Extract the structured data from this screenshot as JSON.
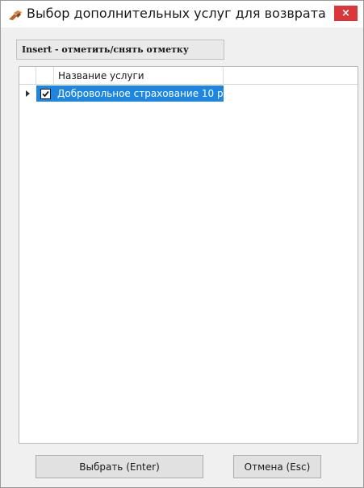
{
  "window": {
    "title": "Выбор дополнительных услуг для возврата",
    "close_label": "×"
  },
  "hint": {
    "text": "Insert - отметить/снять отметку"
  },
  "grid": {
    "columns": [
      "",
      "",
      "Название услуги"
    ],
    "rows": [
      {
        "indicator": "▸",
        "checked": true,
        "name": "Добровольное страхование 10 р"
      }
    ]
  },
  "buttons": {
    "ok_label": "Выбрать (Enter)",
    "cancel_label": "Отмена (Esc)"
  },
  "colors": {
    "selection": "#1e86e0",
    "close_button": "#d9373a"
  }
}
